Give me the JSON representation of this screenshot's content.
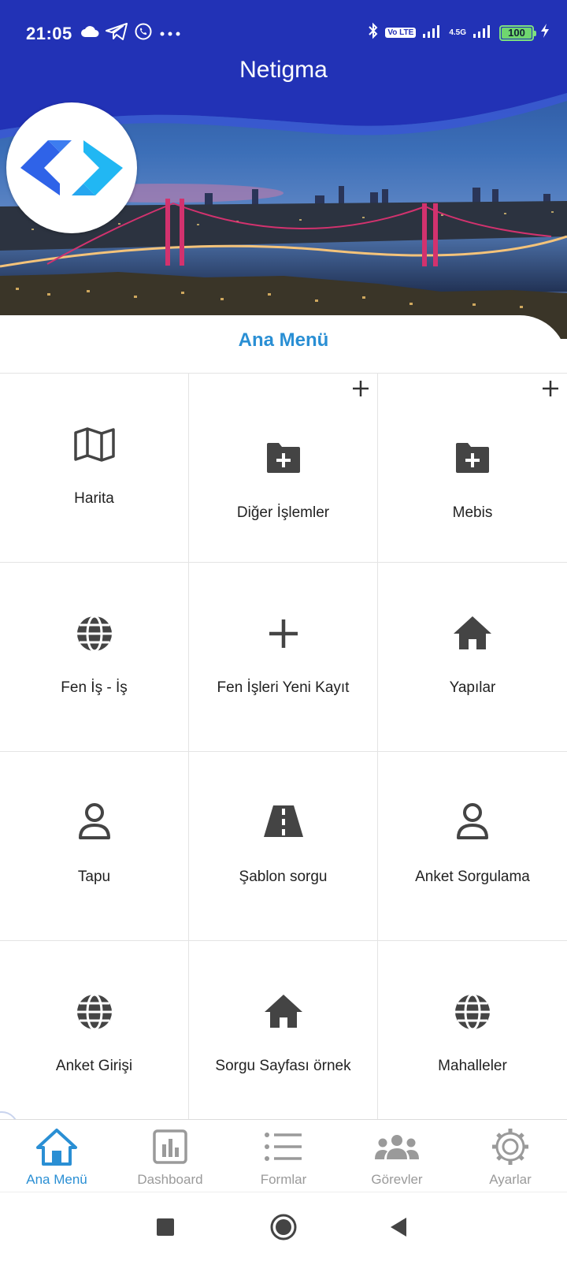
{
  "status_bar": {
    "time": "21:05",
    "left_icons": [
      "cloud-icon",
      "telegram-icon",
      "whatsapp-icon",
      "more-dots-icon"
    ],
    "right_icons": [
      "bluetooth-icon",
      "volte-icon",
      "signal-icon",
      "signal-4.5g-icon",
      "battery-icon",
      "charging-icon"
    ],
    "volte_label": "Vo LTE",
    "network_label": "4.5G",
    "battery_level": "100"
  },
  "header": {
    "title": "Netigma",
    "background_color": "#2232b6",
    "logo": "netigma-logo-icon"
  },
  "main": {
    "section_title": "Ana Menü",
    "tiles": [
      {
        "label": "Harita",
        "icon": "map-icon",
        "has_add": false
      },
      {
        "label": "Diğer İşlemler",
        "icon": "folder-plus-icon",
        "has_add": true
      },
      {
        "label": "Mebis",
        "icon": "folder-plus-icon",
        "has_add": true
      },
      {
        "label": "Fen İş - İş",
        "icon": "globe-icon",
        "has_add": false
      },
      {
        "label": "Fen İşleri Yeni Kayıt",
        "icon": "plus-icon",
        "has_add": false
      },
      {
        "label": "Yapılar",
        "icon": "home-icon",
        "has_add": false
      },
      {
        "label": "Tapu",
        "icon": "user-icon",
        "has_add": false
      },
      {
        "label": "Şablon sorgu",
        "icon": "road-icon",
        "has_add": false
      },
      {
        "label": "Anket Sorgulama",
        "icon": "user-icon",
        "has_add": false
      },
      {
        "label": "Anket Girişi",
        "icon": "globe-icon",
        "has_add": false
      },
      {
        "label": "Sorgu Sayfası örnek",
        "icon": "home-icon",
        "has_add": false
      },
      {
        "label": "Mahalleler",
        "icon": "globe-icon",
        "has_add": false
      }
    ]
  },
  "bottom_nav": {
    "items": [
      {
        "label": "Ana Menü",
        "icon": "home-outline-icon",
        "active": true
      },
      {
        "label": "Dashboard",
        "icon": "bar-chart-icon",
        "active": false
      },
      {
        "label": "Formlar",
        "icon": "list-icon",
        "active": false
      },
      {
        "label": "Görevler",
        "icon": "group-icon",
        "active": false
      },
      {
        "label": "Ayarlar",
        "icon": "settings-icon",
        "active": false
      }
    ]
  },
  "system_nav": {
    "buttons": [
      "recent-apps-icon",
      "home-button-icon",
      "back-icon"
    ]
  },
  "colors": {
    "accent": "#2a8fd4",
    "header_blue": "#2232b6",
    "icon_dark": "#444444",
    "inactive": "#9a9a9a"
  }
}
